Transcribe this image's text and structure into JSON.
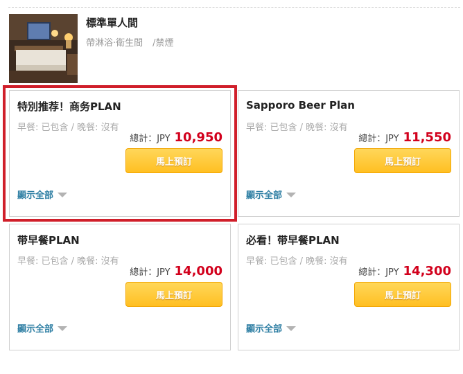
{
  "room": {
    "title": "標準單人間",
    "amenities": "帶淋浴·衛生間",
    "smoking": "/禁煙"
  },
  "plans": [
    {
      "name": "特別推荐！商务PLAN",
      "meal_info": "早餐: 已包含 / 晚餐: 沒有",
      "price_label": "總計：JPY",
      "price": "10,950",
      "book_label": "馬上預訂",
      "show_all_label": "顯示全部"
    },
    {
      "name": "Sapporo Beer Plan",
      "meal_info": "早餐: 已包含 / 晚餐: 沒有",
      "price_label": "總計：JPY",
      "price": "11,550",
      "book_label": "馬上預訂",
      "show_all_label": "顯示全部"
    },
    {
      "name": "带早餐PLAN",
      "meal_info": "早餐: 已包含 / 晚餐: 沒有",
      "price_label": "總計：JPY",
      "price": "14,000",
      "book_label": "馬上預訂",
      "show_all_label": "顯示全部"
    },
    {
      "name": "必看！带早餐PLAN",
      "meal_info": "早餐: 已包含 / 晚餐: 沒有",
      "price_label": "總計：JPY",
      "price": "14,300",
      "book_label": "馬上預訂",
      "show_all_label": "顯示全部"
    }
  ],
  "colors": {
    "price": "#d2001c",
    "link": "#2d7ea3",
    "highlight": "#d01f2a",
    "button": "#ffbf22"
  }
}
